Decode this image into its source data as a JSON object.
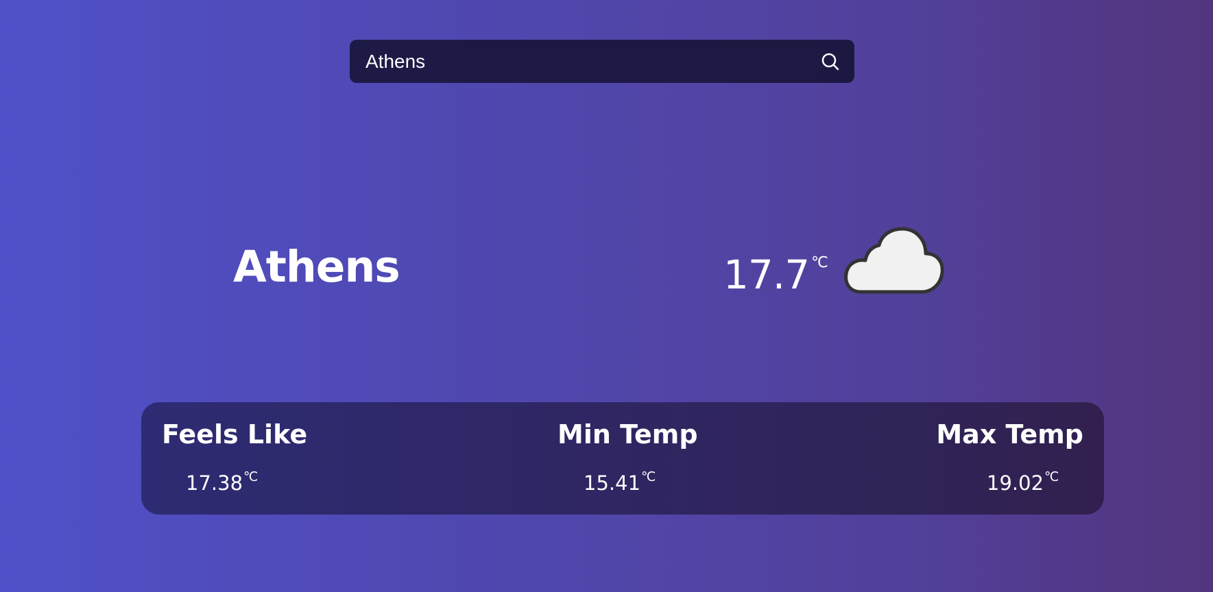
{
  "search": {
    "value": "Athens",
    "icon": "search-icon"
  },
  "current": {
    "city": "Athens",
    "temperature": "17.7",
    "unit": "℃",
    "condition_icon": "cloud-icon"
  },
  "stats": [
    {
      "label": "Feels Like",
      "value": "17.38",
      "unit": "℃"
    },
    {
      "label": "Min Temp",
      "value": "15.41",
      "unit": "℃"
    },
    {
      "label": "Max Temp",
      "value": "19.02",
      "unit": "℃"
    }
  ],
  "colors": {
    "cloud_fill": "#f1f1f1",
    "cloud_stroke": "#333333",
    "text": "#ffffff"
  }
}
